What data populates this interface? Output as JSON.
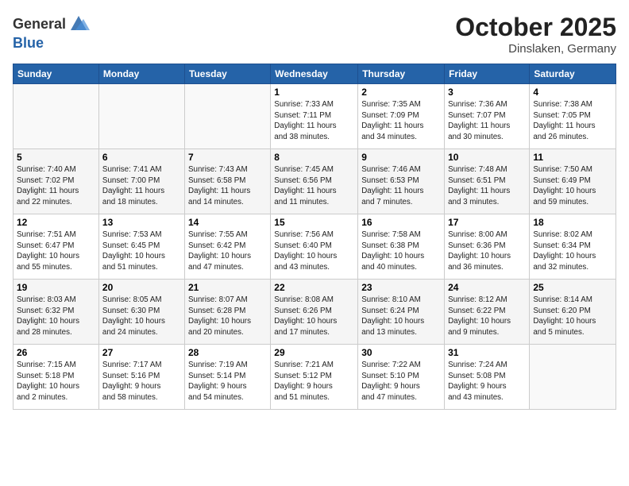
{
  "header": {
    "logo_general": "General",
    "logo_blue": "Blue",
    "month": "October 2025",
    "location": "Dinslaken, Germany"
  },
  "days_of_week": [
    "Sunday",
    "Monday",
    "Tuesday",
    "Wednesday",
    "Thursday",
    "Friday",
    "Saturday"
  ],
  "weeks": [
    [
      {
        "day": "",
        "info": ""
      },
      {
        "day": "",
        "info": ""
      },
      {
        "day": "",
        "info": ""
      },
      {
        "day": "1",
        "info": "Sunrise: 7:33 AM\nSunset: 7:11 PM\nDaylight: 11 hours\nand 38 minutes."
      },
      {
        "day": "2",
        "info": "Sunrise: 7:35 AM\nSunset: 7:09 PM\nDaylight: 11 hours\nand 34 minutes."
      },
      {
        "day": "3",
        "info": "Sunrise: 7:36 AM\nSunset: 7:07 PM\nDaylight: 11 hours\nand 30 minutes."
      },
      {
        "day": "4",
        "info": "Sunrise: 7:38 AM\nSunset: 7:05 PM\nDaylight: 11 hours\nand 26 minutes."
      }
    ],
    [
      {
        "day": "5",
        "info": "Sunrise: 7:40 AM\nSunset: 7:02 PM\nDaylight: 11 hours\nand 22 minutes."
      },
      {
        "day": "6",
        "info": "Sunrise: 7:41 AM\nSunset: 7:00 PM\nDaylight: 11 hours\nand 18 minutes."
      },
      {
        "day": "7",
        "info": "Sunrise: 7:43 AM\nSunset: 6:58 PM\nDaylight: 11 hours\nand 14 minutes."
      },
      {
        "day": "8",
        "info": "Sunrise: 7:45 AM\nSunset: 6:56 PM\nDaylight: 11 hours\nand 11 minutes."
      },
      {
        "day": "9",
        "info": "Sunrise: 7:46 AM\nSunset: 6:53 PM\nDaylight: 11 hours\nand 7 minutes."
      },
      {
        "day": "10",
        "info": "Sunrise: 7:48 AM\nSunset: 6:51 PM\nDaylight: 11 hours\nand 3 minutes."
      },
      {
        "day": "11",
        "info": "Sunrise: 7:50 AM\nSunset: 6:49 PM\nDaylight: 10 hours\nand 59 minutes."
      }
    ],
    [
      {
        "day": "12",
        "info": "Sunrise: 7:51 AM\nSunset: 6:47 PM\nDaylight: 10 hours\nand 55 minutes."
      },
      {
        "day": "13",
        "info": "Sunrise: 7:53 AM\nSunset: 6:45 PM\nDaylight: 10 hours\nand 51 minutes."
      },
      {
        "day": "14",
        "info": "Sunrise: 7:55 AM\nSunset: 6:42 PM\nDaylight: 10 hours\nand 47 minutes."
      },
      {
        "day": "15",
        "info": "Sunrise: 7:56 AM\nSunset: 6:40 PM\nDaylight: 10 hours\nand 43 minutes."
      },
      {
        "day": "16",
        "info": "Sunrise: 7:58 AM\nSunset: 6:38 PM\nDaylight: 10 hours\nand 40 minutes."
      },
      {
        "day": "17",
        "info": "Sunrise: 8:00 AM\nSunset: 6:36 PM\nDaylight: 10 hours\nand 36 minutes."
      },
      {
        "day": "18",
        "info": "Sunrise: 8:02 AM\nSunset: 6:34 PM\nDaylight: 10 hours\nand 32 minutes."
      }
    ],
    [
      {
        "day": "19",
        "info": "Sunrise: 8:03 AM\nSunset: 6:32 PM\nDaylight: 10 hours\nand 28 minutes."
      },
      {
        "day": "20",
        "info": "Sunrise: 8:05 AM\nSunset: 6:30 PM\nDaylight: 10 hours\nand 24 minutes."
      },
      {
        "day": "21",
        "info": "Sunrise: 8:07 AM\nSunset: 6:28 PM\nDaylight: 10 hours\nand 20 minutes."
      },
      {
        "day": "22",
        "info": "Sunrise: 8:08 AM\nSunset: 6:26 PM\nDaylight: 10 hours\nand 17 minutes."
      },
      {
        "day": "23",
        "info": "Sunrise: 8:10 AM\nSunset: 6:24 PM\nDaylight: 10 hours\nand 13 minutes."
      },
      {
        "day": "24",
        "info": "Sunrise: 8:12 AM\nSunset: 6:22 PM\nDaylight: 10 hours\nand 9 minutes."
      },
      {
        "day": "25",
        "info": "Sunrise: 8:14 AM\nSunset: 6:20 PM\nDaylight: 10 hours\nand 5 minutes."
      }
    ],
    [
      {
        "day": "26",
        "info": "Sunrise: 7:15 AM\nSunset: 5:18 PM\nDaylight: 10 hours\nand 2 minutes."
      },
      {
        "day": "27",
        "info": "Sunrise: 7:17 AM\nSunset: 5:16 PM\nDaylight: 9 hours\nand 58 minutes."
      },
      {
        "day": "28",
        "info": "Sunrise: 7:19 AM\nSunset: 5:14 PM\nDaylight: 9 hours\nand 54 minutes."
      },
      {
        "day": "29",
        "info": "Sunrise: 7:21 AM\nSunset: 5:12 PM\nDaylight: 9 hours\nand 51 minutes."
      },
      {
        "day": "30",
        "info": "Sunrise: 7:22 AM\nSunset: 5:10 PM\nDaylight: 9 hours\nand 47 minutes."
      },
      {
        "day": "31",
        "info": "Sunrise: 7:24 AM\nSunset: 5:08 PM\nDaylight: 9 hours\nand 43 minutes."
      },
      {
        "day": "",
        "info": ""
      }
    ]
  ]
}
